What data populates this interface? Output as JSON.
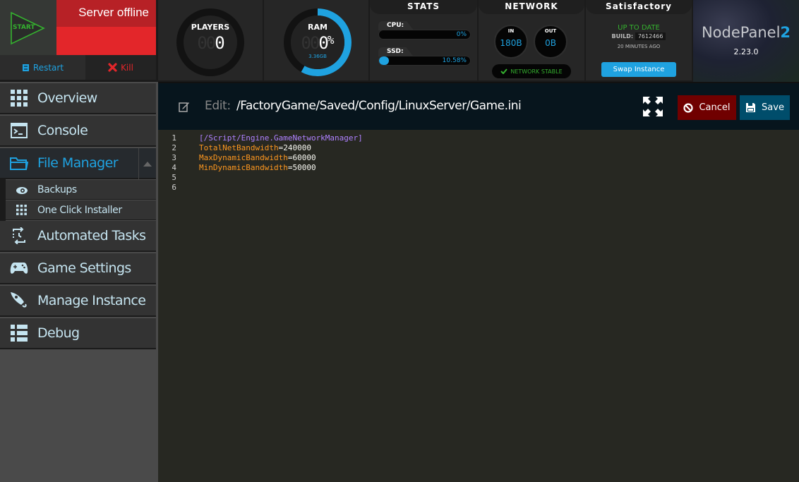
{
  "server": {
    "start_label": "START",
    "status_text": "Server offline",
    "restart_label": "Restart",
    "kill_label": "Kill"
  },
  "players": {
    "label": "PLAYERS",
    "ghost_digits": "00",
    "value": "0"
  },
  "ram": {
    "label": "RAM",
    "ghost_digits": "00",
    "value": "0",
    "unit": "%",
    "size": "3.36GB",
    "ring_fill_fraction": 0.58
  },
  "stats": {
    "title": "STATS",
    "cpu": {
      "label": "CPU:",
      "value_text": "0%",
      "percent": 0
    },
    "ssd": {
      "label": "SSD:",
      "value_text": "10.58%",
      "percent": 10.58
    }
  },
  "network": {
    "title": "NETWORK",
    "in": {
      "label": "IN",
      "value": "180B"
    },
    "out": {
      "label": "OUT",
      "value": "0B"
    },
    "status": "NETWORK STABLE"
  },
  "game": {
    "title": "Satisfactory",
    "update_status": "UP TO DATE",
    "build_label": "BUILD:",
    "build_number": "7612466",
    "updated_ago": "20 MINUTES AGO",
    "swap_label": "Swap Instance"
  },
  "brand": {
    "name": "NodePanel",
    "name_suffix": "2",
    "version": "2.23.0"
  },
  "sidebar": {
    "items": [
      {
        "label": "Overview",
        "icon": "grid-icon"
      },
      {
        "label": "Console",
        "icon": "terminal-icon"
      },
      {
        "label": "File Manager",
        "icon": "folder-icon",
        "active": true
      },
      {
        "label": "Automated Tasks",
        "icon": "scheduled-task-icon"
      },
      {
        "label": "Game Settings",
        "icon": "gamepad-icon"
      },
      {
        "label": "Manage Instance",
        "icon": "rocket-icon"
      },
      {
        "label": "Debug",
        "icon": "list-icon"
      }
    ],
    "file_manager_sub": [
      {
        "label": "Backups",
        "icon": "cloud-backup-icon"
      },
      {
        "label": "One Click Installer",
        "icon": "grid-icon"
      }
    ]
  },
  "editor": {
    "edit_label": "Edit:",
    "file_path": "/FactoryGame/Saved/Config/LinuxServer/Game.ini",
    "cancel_label": "Cancel",
    "save_label": "Save",
    "lines": [
      {
        "num": "1",
        "section": "[/Script/Engine.GameNetworkManager]"
      },
      {
        "num": "2",
        "key": "TotalNetBandwidth",
        "eq": "=",
        "value": "240000"
      },
      {
        "num": "3",
        "key": "MaxDynamicBandwidth",
        "eq": "=",
        "value": "60000"
      },
      {
        "num": "4",
        "key": "MinDynamicBandwidth",
        "eq": "=",
        "value": "50000"
      },
      {
        "num": "5"
      },
      {
        "num": "6"
      }
    ]
  },
  "colors": {
    "accent": "#1fa2e0",
    "offline_red": "#e3262a",
    "ok_green": "#35b12f",
    "cancel": "#700000",
    "save": "#004d6b"
  }
}
